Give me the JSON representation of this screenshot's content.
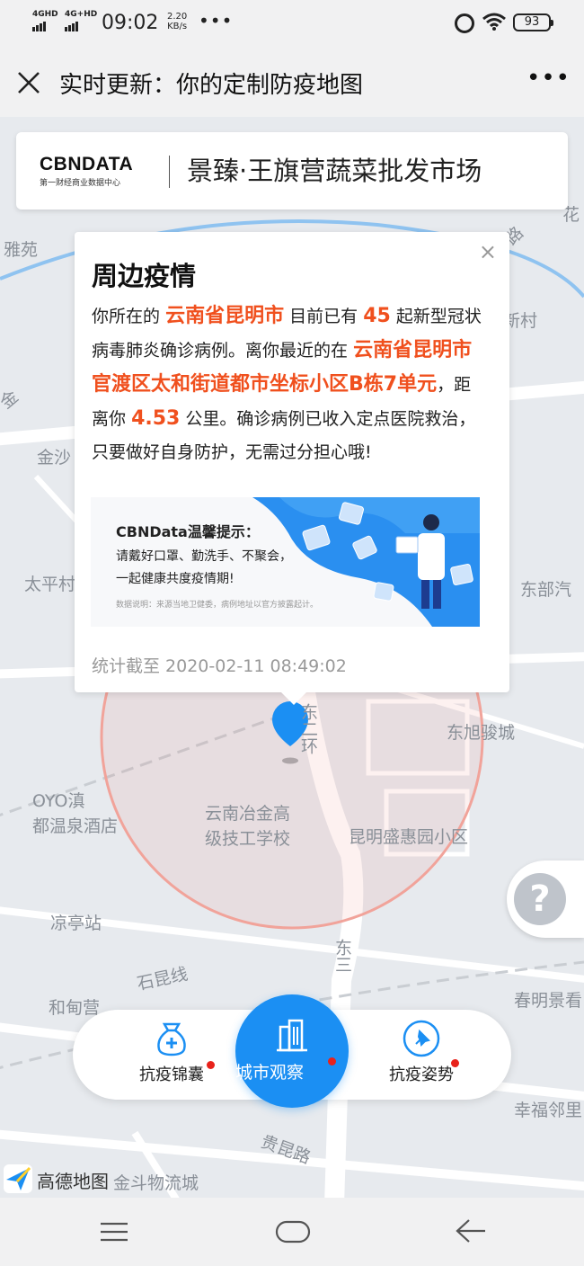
{
  "status_bar": {
    "signal_1": "4GHD",
    "signal_2": "4G+HD",
    "time": "09:02",
    "speed_value": "2.20",
    "speed_unit": "KB/s",
    "more": "•••",
    "battery": "93"
  },
  "title_bar": {
    "title": "实时更新：你的定制防疫地图",
    "more": "•••"
  },
  "banner": {
    "logo_main": "CBNDATA",
    "logo_sub": "第一财经商业数据中心",
    "place": "景臻·王旗营蔬菜批发市场"
  },
  "map": {
    "labels": [
      {
        "text": "雅苑"
      },
      {
        "text": "金沙"
      },
      {
        "text": "太平村"
      },
      {
        "text": "东部汽"
      },
      {
        "text": "东旭骏城"
      },
      {
        "text": "OYO滇"
      },
      {
        "text": "都温泉酒店"
      },
      {
        "text": "云南冶金高"
      },
      {
        "text": "级技工学校"
      },
      {
        "text": "昆明盛惠园小区"
      },
      {
        "text": "凉亭站"
      },
      {
        "text": "石昆线"
      },
      {
        "text": "和甸营"
      },
      {
        "text": "春明景看"
      },
      {
        "text": "幸福邻里"
      },
      {
        "text": "贵昆路"
      },
      {
        "text": "金斗物流城"
      },
      {
        "text": "东二环"
      },
      {
        "text": "东三"
      },
      {
        "text": "新村"
      },
      {
        "text": "花"
      },
      {
        "text": "路"
      },
      {
        "text": "金"
      }
    ]
  },
  "popup": {
    "close": "×",
    "title": "周边疫情",
    "t1": "你所在的",
    "city": "云南省昆明市",
    "t2": "目前已有",
    "count": "45",
    "t3": "起新型冠状病毒肺炎确诊病例。离你最近的在",
    "nearest": "云南省昆明市官渡区太和街道都市坐标小区B栋7单元",
    "t4": "，距离你",
    "distance": "4.53",
    "t5": "公里。确诊病例已收入定点医院救治，只要做好自身防护，无需过分担心哦!",
    "tip_heading": "CBNData温馨提示：",
    "tip_line1": "请戴好口罩、勤洗手、不聚会，",
    "tip_line2": "一起健康共度疫情期!",
    "tip_note": "数据说明：来源当地卫健委，病例地址以官方披露起计。",
    "footer": "统计截至 2020-02-11 08:49:02"
  },
  "tabs": {
    "left": "抗疫锦囊",
    "center": "城市观察",
    "right": "抗疫姿势"
  },
  "help": "?",
  "amap_label": "高德地图",
  "colors": {
    "accent_blue": "#1b8ff3",
    "highlight_orange": "#f0501e",
    "badge_red": "#e8221b"
  }
}
